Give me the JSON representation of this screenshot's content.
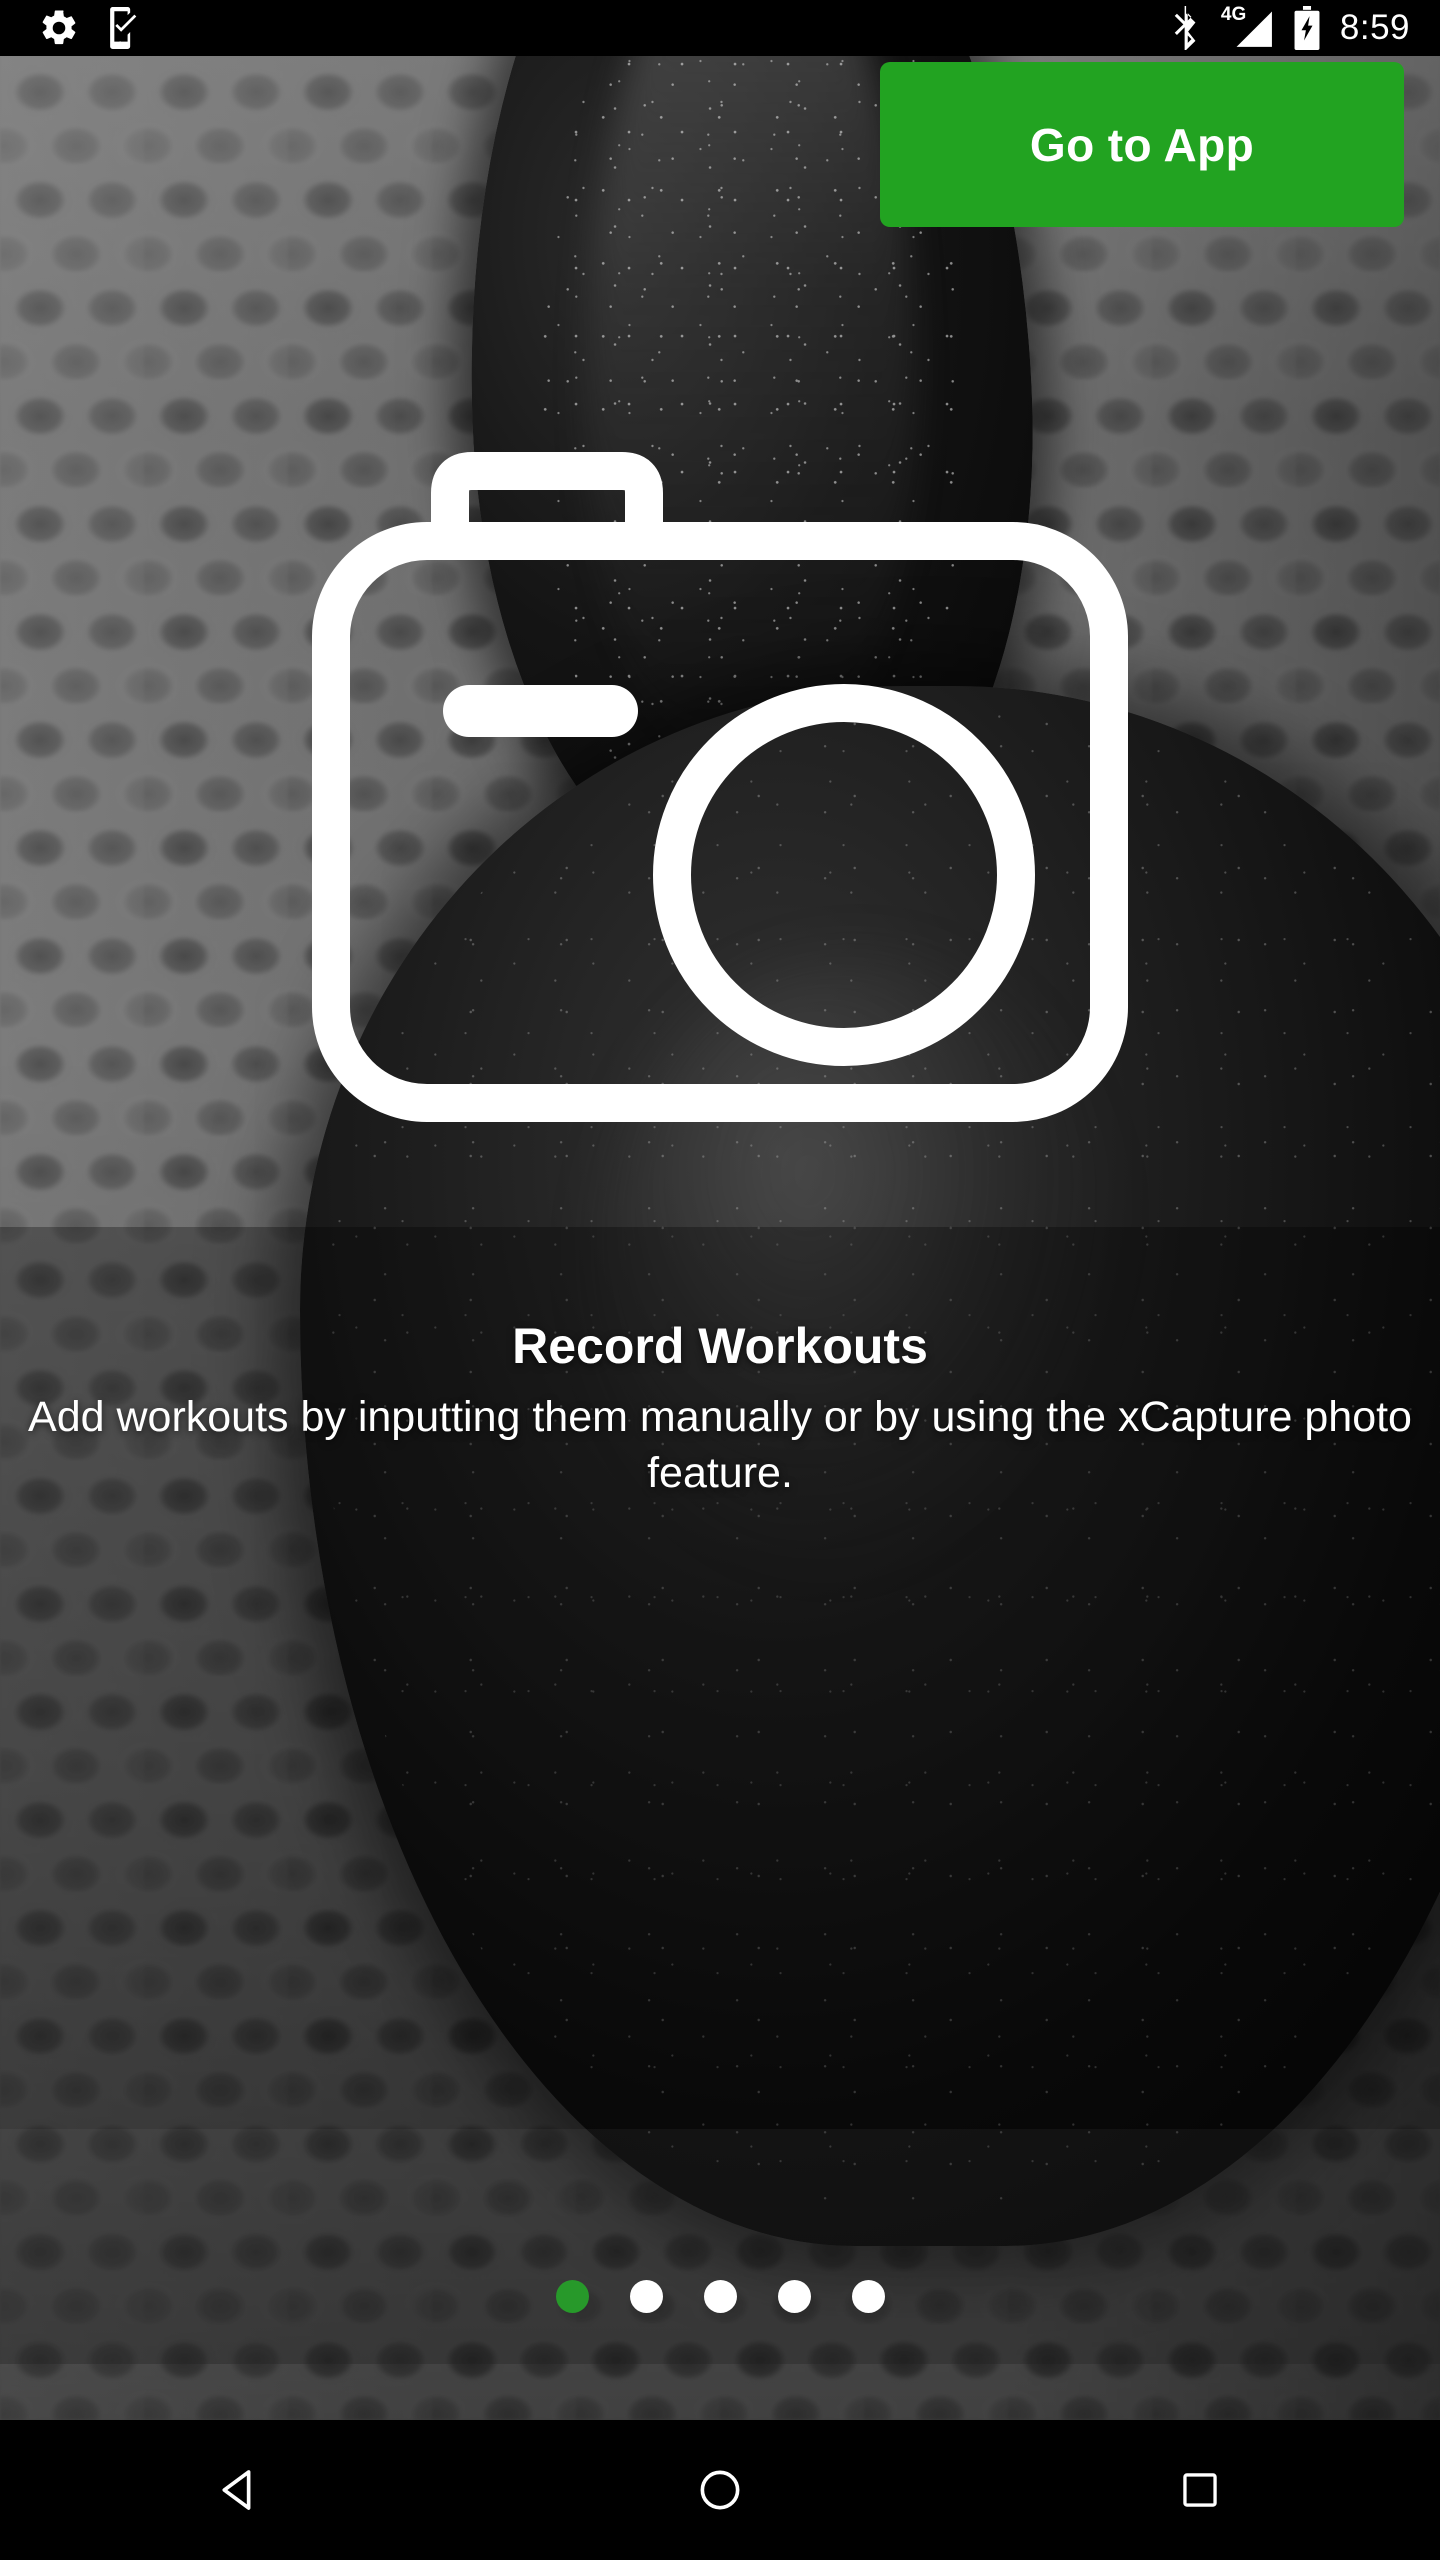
{
  "status_bar": {
    "left_icons": [
      {
        "name": "settings-gear-icon",
        "label": "Settings"
      },
      {
        "name": "phone-check-icon",
        "label": "Device check"
      }
    ],
    "right_icons": [
      {
        "name": "bluetooth-icon",
        "label": "Bluetooth"
      },
      {
        "name": "signal-icon",
        "label": "Mobile signal"
      },
      {
        "name": "battery-charging-icon",
        "label": "Battery charging"
      }
    ],
    "network_type": "4G",
    "time": "8:59"
  },
  "header": {
    "go_to_app_label": "Go to App"
  },
  "hero": {
    "icon_name": "camera-icon"
  },
  "onboarding": {
    "title": "Record Workouts",
    "description": "Add workouts by inputting them manually or by using the xCapture photo feature."
  },
  "page_indicator": {
    "total": 5,
    "active_index": 0,
    "dots": [
      {
        "active": true
      },
      {
        "active": false
      },
      {
        "active": false
      },
      {
        "active": false
      },
      {
        "active": false
      }
    ]
  },
  "nav_bar": {
    "buttons": [
      {
        "name": "back-button",
        "label": "Back"
      },
      {
        "name": "home-button",
        "label": "Home"
      },
      {
        "name": "recents-button",
        "label": "Recent apps"
      }
    ]
  },
  "colors": {
    "accent_green": "#22a321",
    "dot_active_green": "#27992a",
    "status_bar_bg": "#000000",
    "nav_bar_bg": "#000000",
    "text_white": "#ffffff"
  }
}
